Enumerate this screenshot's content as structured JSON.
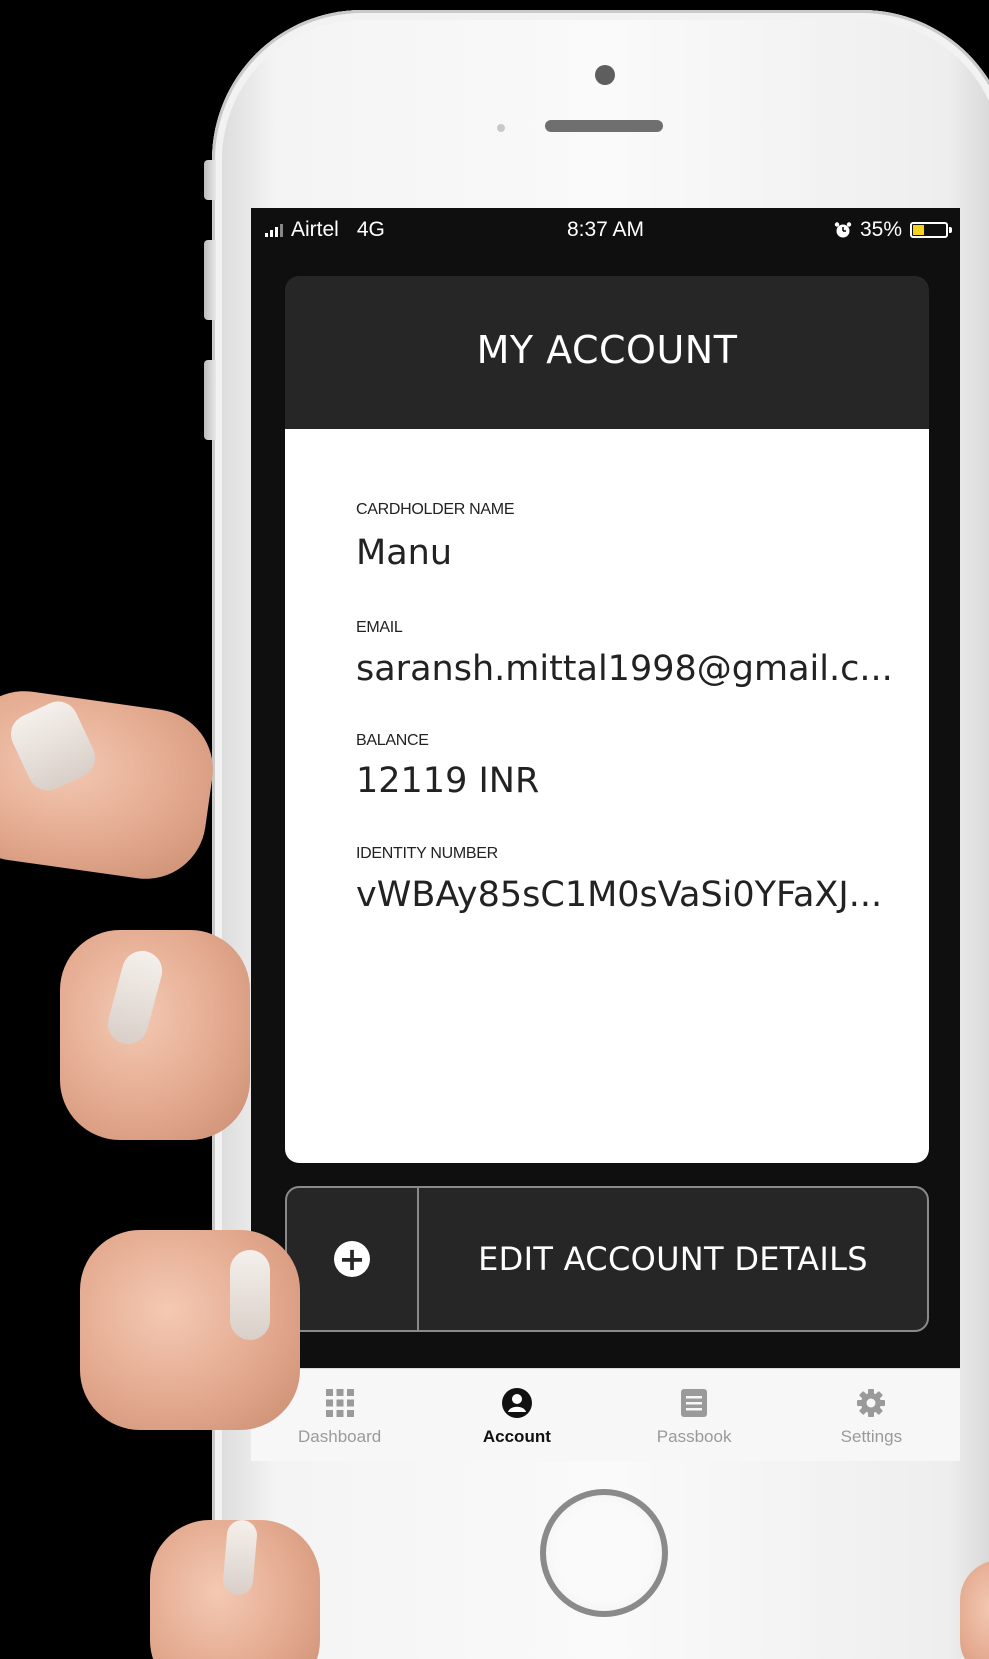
{
  "status_bar": {
    "carrier": "Airtel",
    "network": "4G",
    "time": "8:37 AM",
    "battery_percent": "35%",
    "battery_level": 0.35,
    "alarm_icon": "alarm-clock-icon"
  },
  "header": {
    "title": "MY ACCOUNT"
  },
  "account": {
    "cardholder_label": "CARDHOLDER NAME",
    "cardholder_value": "Manu",
    "email_label": "EMAIL",
    "email_value": "saransh.mittal1998@gmail.c...",
    "balance_label": "BALANCE",
    "balance_value": "12119 INR",
    "identity_label": "IDENTITY NUMBER",
    "identity_value": "vWBAy85sC1M0sVaSi0YFaXJ..."
  },
  "edit_button": {
    "label": "EDIT ACCOUNT DETAILS",
    "icon": "plus-circle-icon"
  },
  "tabs": [
    {
      "label": "Dashboard",
      "icon": "grid-icon",
      "active": false
    },
    {
      "label": "Account",
      "icon": "user-circle-icon",
      "active": true
    },
    {
      "label": "Passbook",
      "icon": "book-icon",
      "active": false
    },
    {
      "label": "Settings",
      "icon": "gear-icon",
      "active": false
    }
  ],
  "colors": {
    "screen_bg": "#0f0f0f",
    "card_dark": "#262626",
    "card_light": "#ffffff",
    "battery_fill": "#f2d21c"
  }
}
